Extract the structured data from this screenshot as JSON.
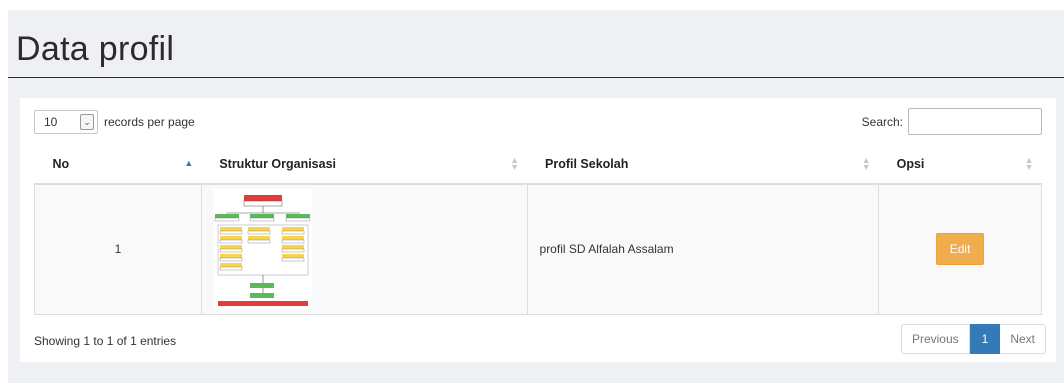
{
  "page": {
    "title": "Data profil"
  },
  "table_controls": {
    "length_value": "10",
    "length_label": "records per page",
    "search_label": "Search:",
    "search_value": ""
  },
  "table": {
    "columns": [
      "No",
      "Struktur Organisasi",
      "Profil Sekolah",
      "Opsi"
    ],
    "sorted_column": "No",
    "rows": [
      {
        "no": "1",
        "struktur_image": "organization-chart-thumbnail",
        "profil": "profil SD Alfalah Assalam",
        "action_label": "Edit"
      }
    ]
  },
  "footer": {
    "info": "Showing 1 to 1 of 1 entries",
    "pagination": {
      "previous": "Previous",
      "current": "1",
      "next": "Next"
    }
  },
  "colors": {
    "page_background": "#eef0f4",
    "edit_button": "#f0ad4e",
    "pagination_active": "#337ab7",
    "sort_active": "#337ab7"
  }
}
